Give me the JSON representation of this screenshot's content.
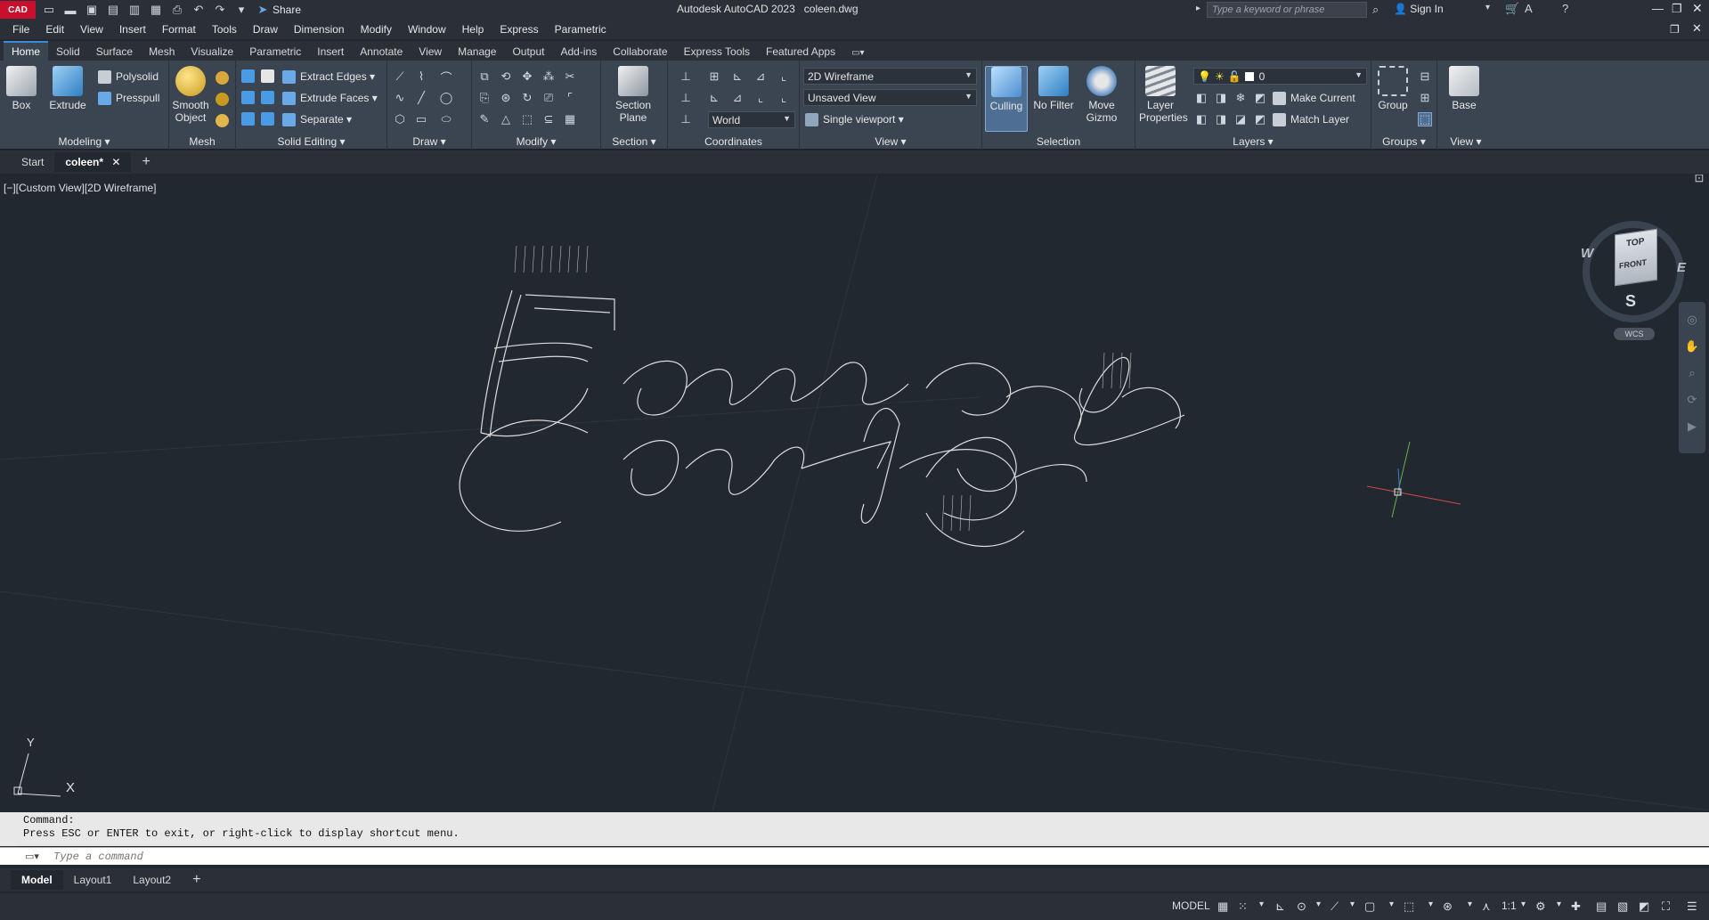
{
  "app": {
    "logo_text": "CAD",
    "title": "Autodesk AutoCAD 2023",
    "file_name": "coleen.dwg",
    "share_label": "Share",
    "search_placeholder": "Type a keyword or phrase",
    "sign_in_label": "Sign In"
  },
  "menu": [
    "File",
    "Edit",
    "View",
    "Insert",
    "Format",
    "Tools",
    "Draw",
    "Dimension",
    "Modify",
    "Window",
    "Help",
    "Express",
    "Parametric"
  ],
  "ribbon_tabs": [
    "Home",
    "Solid",
    "Surface",
    "Mesh",
    "Visualize",
    "Parametric",
    "Insert",
    "Annotate",
    "View",
    "Manage",
    "Output",
    "Add-ins",
    "Collaborate",
    "Express Tools",
    "Featured Apps"
  ],
  "ribbon": {
    "modeling": {
      "title": "Modeling",
      "box": "Box",
      "extrude": "Extrude",
      "polysolid": "Polysolid",
      "presspull": "Presspull"
    },
    "mesh": {
      "title": "Mesh",
      "smooth_object_l1": "Smooth",
      "smooth_object_l2": "Object"
    },
    "solid_editing": {
      "title": "Solid Editing",
      "extract_edges": "Extract Edges",
      "extrude_faces": "Extrude Faces",
      "separate": "Separate"
    },
    "draw": {
      "title": "Draw"
    },
    "modify": {
      "title": "Modify"
    },
    "section": {
      "title": "Section",
      "section_plane_l1": "Section",
      "section_plane_l2": "Plane"
    },
    "coordinates": {
      "title": "Coordinates",
      "world": "World"
    },
    "view": {
      "title": "View",
      "visual_style": "2D Wireframe",
      "named_view": "Unsaved View",
      "viewport": "Single viewport"
    },
    "selection": {
      "title": "Selection",
      "culling": "Culling",
      "no_filter": "No Filter",
      "move_gizmo_l1": "Move",
      "move_gizmo_l2": "Gizmo"
    },
    "layers": {
      "title": "Layers",
      "layer_properties_l1": "Layer",
      "layer_properties_l2": "Properties",
      "current_layer": "0",
      "make_current": "Make Current",
      "match_layer": "Match Layer"
    },
    "groups": {
      "title": "Groups",
      "group": "Group"
    },
    "view2": {
      "title": "View",
      "base": "Base"
    }
  },
  "doc_tabs": {
    "start": "Start",
    "current": "coleen*"
  },
  "viewport": {
    "label": "[−][Custom View][2D Wireframe]",
    "viewcube": {
      "top": "TOP",
      "front": "FRONT",
      "west": "W",
      "east": "E",
      "south": "S",
      "wcs": "WCS"
    },
    "ucs": {
      "x": "X",
      "y": "Y"
    }
  },
  "command": {
    "line1": "Command:",
    "line2": "Press ESC or ENTER to exit, or right-click to display shortcut menu.",
    "placeholder": "Type a command"
  },
  "layout_tabs": [
    "Model",
    "Layout1",
    "Layout2"
  ],
  "status": {
    "model": "MODEL",
    "scale": "1:1"
  },
  "colors": {
    "background": "#212830",
    "ribbon": "#3b4451",
    "accent": "#3b8ad9",
    "logo": "#c8102e"
  }
}
